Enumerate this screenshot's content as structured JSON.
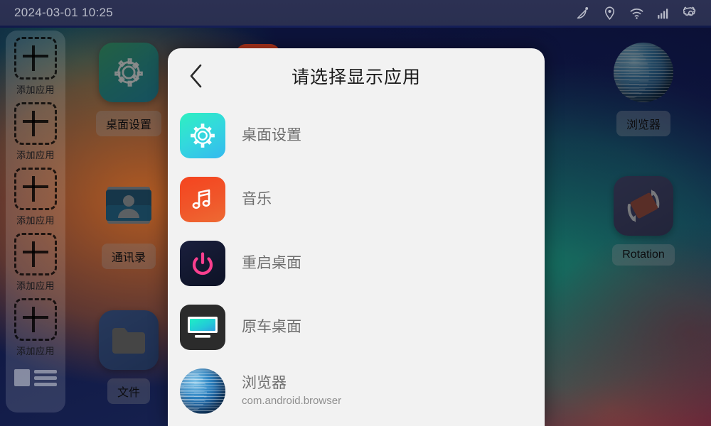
{
  "statusbar": {
    "clock": "2024-03-01 10:25",
    "icons": [
      "satellite-icon",
      "location-icon",
      "wifi-icon",
      "signal-icon",
      "gear-icon"
    ]
  },
  "sidebar": {
    "add_slots": [
      {
        "label": "添加应用"
      },
      {
        "label": "添加应用"
      },
      {
        "label": "添加应用"
      },
      {
        "label": "添加应用"
      },
      {
        "label": "添加应用"
      }
    ],
    "layout_toggle": "list-layout-toggle"
  },
  "desktop": {
    "apps": [
      {
        "label": "桌面设置",
        "icon": "gear-icon"
      },
      {
        "label": "通讯录",
        "icon": "contacts-icon"
      },
      {
        "label": "文件",
        "icon": "folder-icon"
      },
      {
        "label": "浏览器",
        "icon": "globe-icon"
      },
      {
        "label": "Rotation",
        "icon": "rotation-icon"
      }
    ]
  },
  "dialog": {
    "title": "请选择显示应用",
    "back": "‹",
    "apps": [
      {
        "name": "桌面设置",
        "pkg": "",
        "icon": "gear-icon"
      },
      {
        "name": "音乐",
        "pkg": "",
        "icon": "music-note-icon"
      },
      {
        "name": "重启桌面",
        "pkg": "",
        "icon": "power-icon"
      },
      {
        "name": "原车桌面",
        "pkg": "",
        "icon": "monitor-icon"
      },
      {
        "name": "浏览器",
        "pkg": "com.android.browser",
        "icon": "globe-icon"
      }
    ]
  },
  "colors": {
    "statusbar_bg": "#2c3153",
    "dialog_bg": "#f2f2f2",
    "title_text": "#1b1b1b",
    "list_text": "#6e6e6e",
    "pkg_text": "#8e8e8e",
    "clock_text": "#b9bcc9"
  }
}
